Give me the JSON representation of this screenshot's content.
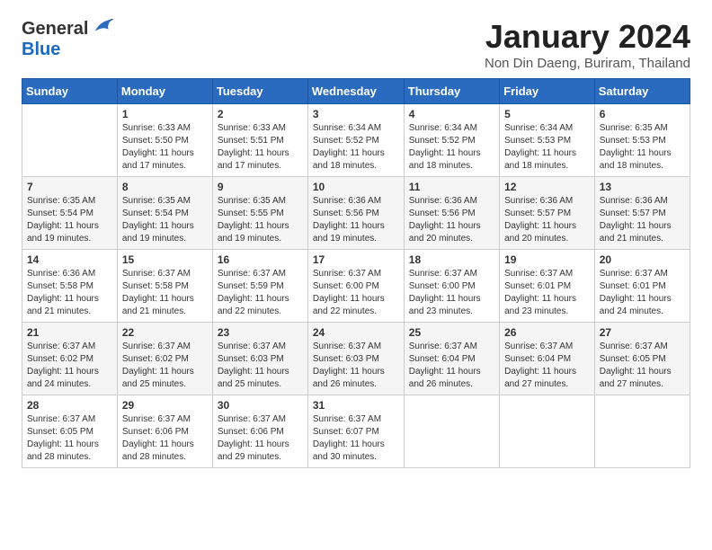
{
  "header": {
    "logo_general": "General",
    "logo_blue": "Blue",
    "month_title": "January 2024",
    "location": "Non Din Daeng, Buriram, Thailand"
  },
  "days_of_week": [
    "Sunday",
    "Monday",
    "Tuesday",
    "Wednesday",
    "Thursday",
    "Friday",
    "Saturday"
  ],
  "weeks": [
    [
      {
        "day": "",
        "info": ""
      },
      {
        "day": "1",
        "info": "Sunrise: 6:33 AM\nSunset: 5:50 PM\nDaylight: 11 hours\nand 17 minutes."
      },
      {
        "day": "2",
        "info": "Sunrise: 6:33 AM\nSunset: 5:51 PM\nDaylight: 11 hours\nand 17 minutes."
      },
      {
        "day": "3",
        "info": "Sunrise: 6:34 AM\nSunset: 5:52 PM\nDaylight: 11 hours\nand 18 minutes."
      },
      {
        "day": "4",
        "info": "Sunrise: 6:34 AM\nSunset: 5:52 PM\nDaylight: 11 hours\nand 18 minutes."
      },
      {
        "day": "5",
        "info": "Sunrise: 6:34 AM\nSunset: 5:53 PM\nDaylight: 11 hours\nand 18 minutes."
      },
      {
        "day": "6",
        "info": "Sunrise: 6:35 AM\nSunset: 5:53 PM\nDaylight: 11 hours\nand 18 minutes."
      }
    ],
    [
      {
        "day": "7",
        "info": "Sunrise: 6:35 AM\nSunset: 5:54 PM\nDaylight: 11 hours\nand 19 minutes."
      },
      {
        "day": "8",
        "info": "Sunrise: 6:35 AM\nSunset: 5:54 PM\nDaylight: 11 hours\nand 19 minutes."
      },
      {
        "day": "9",
        "info": "Sunrise: 6:35 AM\nSunset: 5:55 PM\nDaylight: 11 hours\nand 19 minutes."
      },
      {
        "day": "10",
        "info": "Sunrise: 6:36 AM\nSunset: 5:56 PM\nDaylight: 11 hours\nand 19 minutes."
      },
      {
        "day": "11",
        "info": "Sunrise: 6:36 AM\nSunset: 5:56 PM\nDaylight: 11 hours\nand 20 minutes."
      },
      {
        "day": "12",
        "info": "Sunrise: 6:36 AM\nSunset: 5:57 PM\nDaylight: 11 hours\nand 20 minutes."
      },
      {
        "day": "13",
        "info": "Sunrise: 6:36 AM\nSunset: 5:57 PM\nDaylight: 11 hours\nand 21 minutes."
      }
    ],
    [
      {
        "day": "14",
        "info": "Sunrise: 6:36 AM\nSunset: 5:58 PM\nDaylight: 11 hours\nand 21 minutes."
      },
      {
        "day": "15",
        "info": "Sunrise: 6:37 AM\nSunset: 5:58 PM\nDaylight: 11 hours\nand 21 minutes."
      },
      {
        "day": "16",
        "info": "Sunrise: 6:37 AM\nSunset: 5:59 PM\nDaylight: 11 hours\nand 22 minutes."
      },
      {
        "day": "17",
        "info": "Sunrise: 6:37 AM\nSunset: 6:00 PM\nDaylight: 11 hours\nand 22 minutes."
      },
      {
        "day": "18",
        "info": "Sunrise: 6:37 AM\nSunset: 6:00 PM\nDaylight: 11 hours\nand 23 minutes."
      },
      {
        "day": "19",
        "info": "Sunrise: 6:37 AM\nSunset: 6:01 PM\nDaylight: 11 hours\nand 23 minutes."
      },
      {
        "day": "20",
        "info": "Sunrise: 6:37 AM\nSunset: 6:01 PM\nDaylight: 11 hours\nand 24 minutes."
      }
    ],
    [
      {
        "day": "21",
        "info": "Sunrise: 6:37 AM\nSunset: 6:02 PM\nDaylight: 11 hours\nand 24 minutes."
      },
      {
        "day": "22",
        "info": "Sunrise: 6:37 AM\nSunset: 6:02 PM\nDaylight: 11 hours\nand 25 minutes."
      },
      {
        "day": "23",
        "info": "Sunrise: 6:37 AM\nSunset: 6:03 PM\nDaylight: 11 hours\nand 25 minutes."
      },
      {
        "day": "24",
        "info": "Sunrise: 6:37 AM\nSunset: 6:03 PM\nDaylight: 11 hours\nand 26 minutes."
      },
      {
        "day": "25",
        "info": "Sunrise: 6:37 AM\nSunset: 6:04 PM\nDaylight: 11 hours\nand 26 minutes."
      },
      {
        "day": "26",
        "info": "Sunrise: 6:37 AM\nSunset: 6:04 PM\nDaylight: 11 hours\nand 27 minutes."
      },
      {
        "day": "27",
        "info": "Sunrise: 6:37 AM\nSunset: 6:05 PM\nDaylight: 11 hours\nand 27 minutes."
      }
    ],
    [
      {
        "day": "28",
        "info": "Sunrise: 6:37 AM\nSunset: 6:05 PM\nDaylight: 11 hours\nand 28 minutes."
      },
      {
        "day": "29",
        "info": "Sunrise: 6:37 AM\nSunset: 6:06 PM\nDaylight: 11 hours\nand 28 minutes."
      },
      {
        "day": "30",
        "info": "Sunrise: 6:37 AM\nSunset: 6:06 PM\nDaylight: 11 hours\nand 29 minutes."
      },
      {
        "day": "31",
        "info": "Sunrise: 6:37 AM\nSunset: 6:07 PM\nDaylight: 11 hours\nand 30 minutes."
      },
      {
        "day": "",
        "info": ""
      },
      {
        "day": "",
        "info": ""
      },
      {
        "day": "",
        "info": ""
      }
    ]
  ]
}
